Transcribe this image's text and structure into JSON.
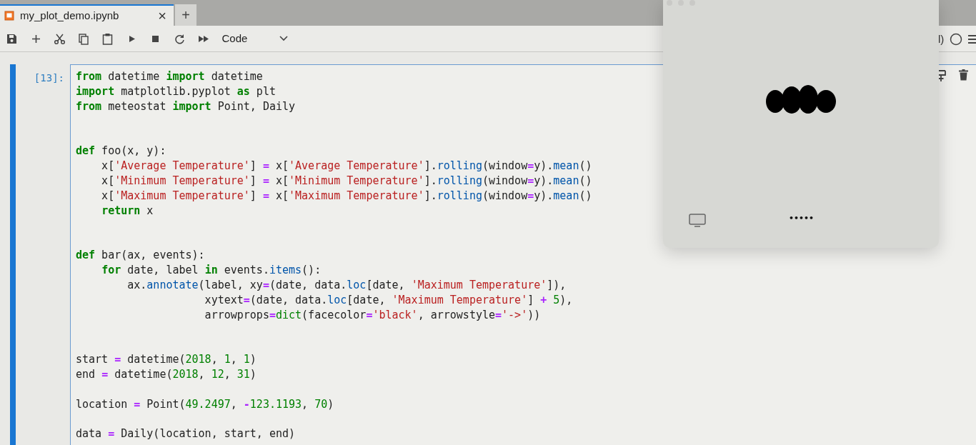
{
  "tabs": [
    {
      "label": "my_plot_demo.ipynb",
      "selected": true,
      "close": "×"
    }
  ],
  "new_tab": "+",
  "toolbar": {
    "cell_type": "Code",
    "kernel_partial": "l)"
  },
  "cell": {
    "prompt": "[13]:",
    "active": true,
    "blocks": [
      {
        "kind": "first",
        "lines": [
          "from datetime import datetime",
          "import matplotlib.pyplot as plt",
          "from meteostat import Point, Daily"
        ]
      },
      {
        "kind": "after_two_blanks",
        "lines": [
          "def foo(x, y):",
          "    x['Average Temperature'] = x['Average Temperature'].rolling(window=y).mean()",
          "    x['Minimum Temperature'] = x['Minimum Temperature'].rolling(window=y).mean()",
          "    x['Maximum Temperature'] = x['Maximum Temperature'].rolling(window=y).mean()",
          "    return x"
        ]
      },
      {
        "kind": "after_two_blanks",
        "lines": [
          "def bar(ax, events):",
          "    for date, label in events.items():",
          "        ax.annotate(label, xy=(date, data.loc[date, 'Maximum Temperature']),",
          "                    xytext=(date, data.loc[date, 'Maximum Temperature'] + 5),",
          "                    arrowprops=dict(facecolor='black', arrowstyle='->'))"
        ]
      },
      {
        "kind": "after_two_blanks",
        "lines": [
          "start = datetime(2018, 1, 1)",
          "end = datetime(2018, 12, 31)"
        ]
      },
      {
        "kind": "after_one_blank",
        "lines": [
          "location = Point(49.2497, -123.1193, 70)"
        ]
      },
      {
        "kind": "after_one_blank",
        "lines": [
          "data = Daily(location, start, end)"
        ]
      }
    ]
  },
  "popup": {
    "masked_text": "•••••"
  }
}
